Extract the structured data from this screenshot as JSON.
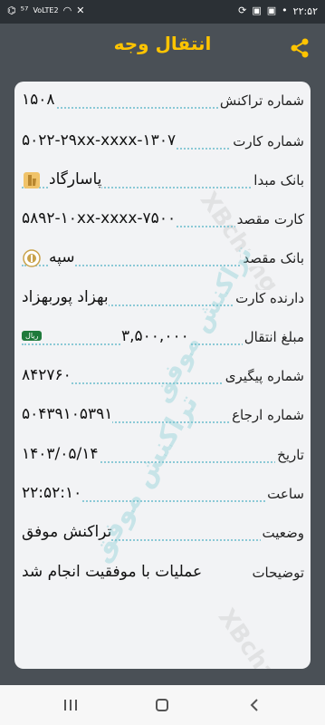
{
  "status_bar": {
    "network": "⁵⁷",
    "signal_label": "VoLTE2",
    "time": "۲۲:۵۲"
  },
  "header": {
    "title": "انتقال وجه"
  },
  "watermark": {
    "text": "تراکنش موفق",
    "brand": "XBchange"
  },
  "rows": [
    {
      "label": "شماره تراکنش",
      "value": "۱۵۰۸"
    },
    {
      "label": "شماره کارت",
      "value": "۵۰۲۲-۲۹xx-xxxx-۱۳۰۷"
    },
    {
      "label": "بانک مبدا",
      "value": "پاسارگاد"
    },
    {
      "label": "کارت مقصد",
      "value": "۵۸۹۲-۱۰xx-xxxx-۷۵۰۰"
    },
    {
      "label": "بانک مقصد",
      "value": "سپه"
    },
    {
      "label": "دارنده کارت",
      "value": "بهزاد پوربهزاد"
    },
    {
      "label": "مبلغ انتقال",
      "value": "۳,۵۰۰,۰۰۰",
      "unit": "ریال"
    },
    {
      "label": "شماره پیگیری",
      "value": "۸۴۲۷۶۰"
    },
    {
      "label": "شماره ارجاع",
      "value": "۵۰۴۳۹۱۰۵۳۹۱"
    },
    {
      "label": "تاریخ",
      "value": "۱۴۰۳/۰۵/۱۴"
    },
    {
      "label": "ساعت",
      "value": "۲۲:۵۲:۱۰"
    },
    {
      "label": "وضعیت",
      "value": "تراکنش موفق"
    },
    {
      "label": "توضیحات",
      "value": "عملیات با موفقیت انجام شد"
    }
  ],
  "colors": {
    "accent": "#ffc400",
    "background": "#4a5056",
    "card": "#f2f3f5",
    "dots": "#8bc9d6"
  }
}
